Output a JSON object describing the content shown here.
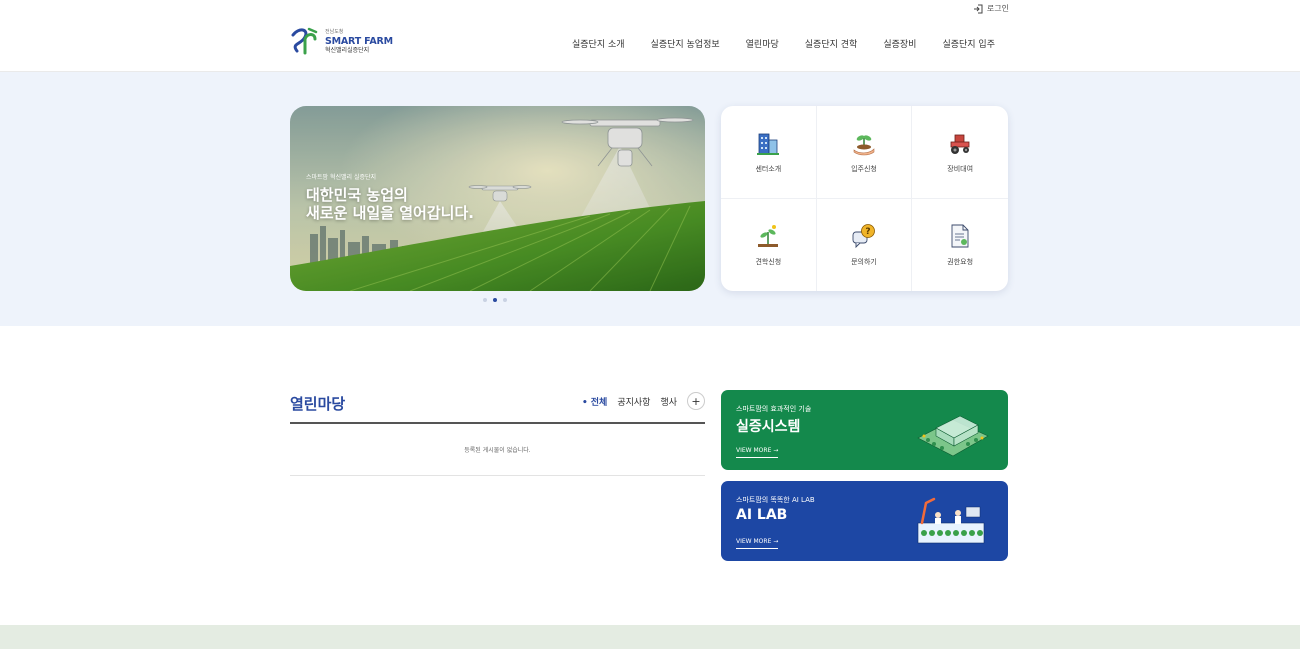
{
  "util": {
    "login_label": "로그인",
    "login_icon": "login-icon"
  },
  "logo": {
    "small": "전남도청",
    "main": "SMART FARM",
    "sub": "혁신밸리실증단지"
  },
  "nav": {
    "items": [
      "실증단지 소개",
      "실증단지 농업정보",
      "열린마당",
      "실증단지 견학",
      "실증장비",
      "실증단지 입주"
    ]
  },
  "banner": {
    "eyebrow": "스마트팜 혁신밸리 실증단지",
    "title_line1": "대한민국 농업의",
    "title_line2": "새로운 내일을 열어갑니다.",
    "slide_count": 3,
    "active_slide": 2
  },
  "quick_menu": {
    "items": [
      {
        "label": "센터소개",
        "icon": "building-icon"
      },
      {
        "label": "입주신청",
        "icon": "sprout-hand-icon"
      },
      {
        "label": "장비대여",
        "icon": "tractor-icon"
      },
      {
        "label": "견학신청",
        "icon": "plant-tour-icon"
      },
      {
        "label": "문의하기",
        "icon": "question-bubble-icon"
      },
      {
        "label": "권한요청",
        "icon": "document-request-icon"
      }
    ]
  },
  "board": {
    "title": "열린마당",
    "tabs": [
      "전체",
      "공지사항",
      "행사"
    ],
    "active_tab": "전체",
    "more_label": "+",
    "empty_message": "등록된 게시물이 없습니다."
  },
  "promos": [
    {
      "eyebrow": "스마트팜의 효과적인 기술",
      "title": "실증시스템",
      "more": "VIEW MORE  →",
      "color": "#14894c"
    },
    {
      "eyebrow": "스마트팜의 똑똑한 AI LAB",
      "title": "AI LAB",
      "more": "VIEW MORE  →",
      "color": "#1d47a4"
    }
  ],
  "colors": {
    "brand_blue": "#2a4aa0",
    "visual_bg": "#eef3fb",
    "footer_bg": "#e4ece2"
  }
}
